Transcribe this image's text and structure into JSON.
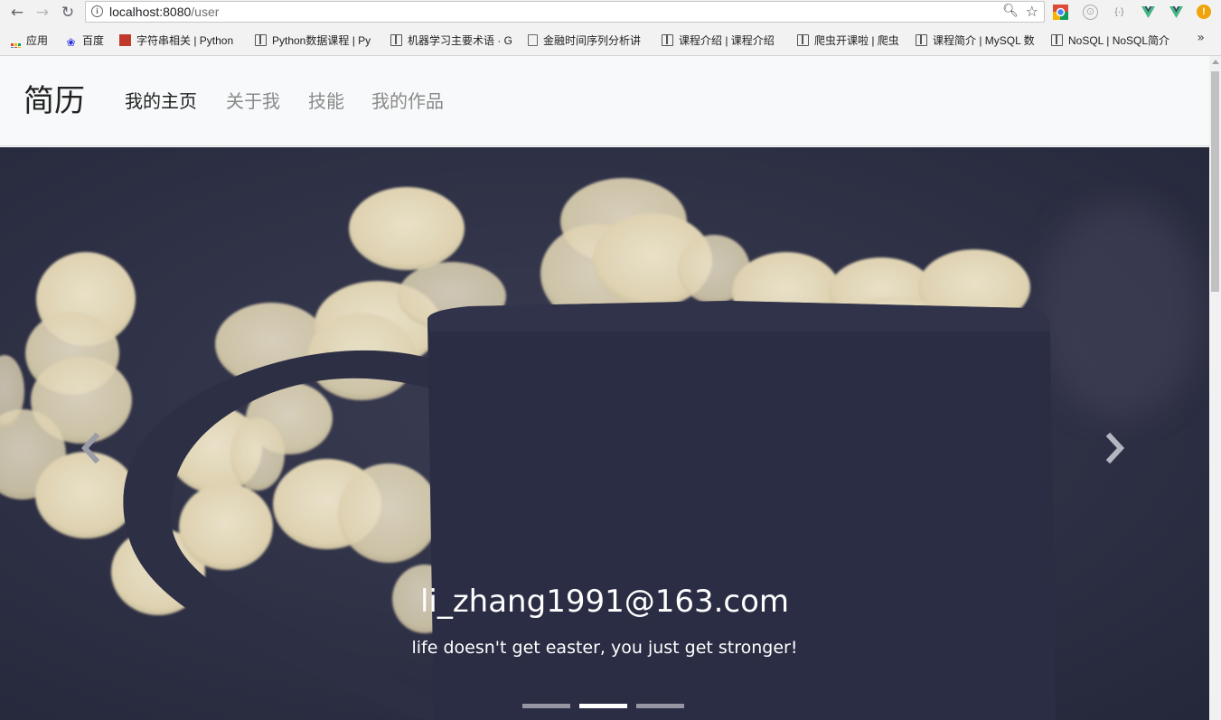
{
  "browser": {
    "url_host": "localhost:8080",
    "url_path": "/user"
  },
  "bookmarks": [
    {
      "label": "应用",
      "icon": "apps-icon"
    },
    {
      "label": "百度",
      "icon": "baidu-paw-icon"
    },
    {
      "label": "字符串相关 | Python",
      "icon": "site-favicon"
    },
    {
      "label": "Python数据课程 | Py",
      "icon": "book-icon"
    },
    {
      "label": "机器学习主要术语 · G",
      "icon": "book-icon"
    },
    {
      "label": "金融时间序列分析讲",
      "icon": "file-icon"
    },
    {
      "label": "课程介绍 | 课程介绍",
      "icon": "book-icon"
    },
    {
      "label": "爬虫开课啦 | 爬虫",
      "icon": "book-icon"
    },
    {
      "label": "课程简介 | MySQL 数",
      "icon": "book-icon"
    },
    {
      "label": "NoSQL | NoSQL简介",
      "icon": "book-icon"
    }
  ],
  "navbar": {
    "brand": "简历",
    "links": [
      {
        "label": "我的主页",
        "active": true
      },
      {
        "label": "关于我",
        "active": false
      },
      {
        "label": "技能",
        "active": false
      },
      {
        "label": "我的作品",
        "active": false
      }
    ]
  },
  "carousel": {
    "caption_title": "li_zhang1991@163.com",
    "caption_text": "life doesn't get easter, you just get stronger!",
    "slide_count": 3,
    "active_index": 1
  },
  "colors": {
    "navbar_bg": "#f8f9fa",
    "carousel_bg": "#2a2c40",
    "bokeh": "#f1e6c4"
  }
}
